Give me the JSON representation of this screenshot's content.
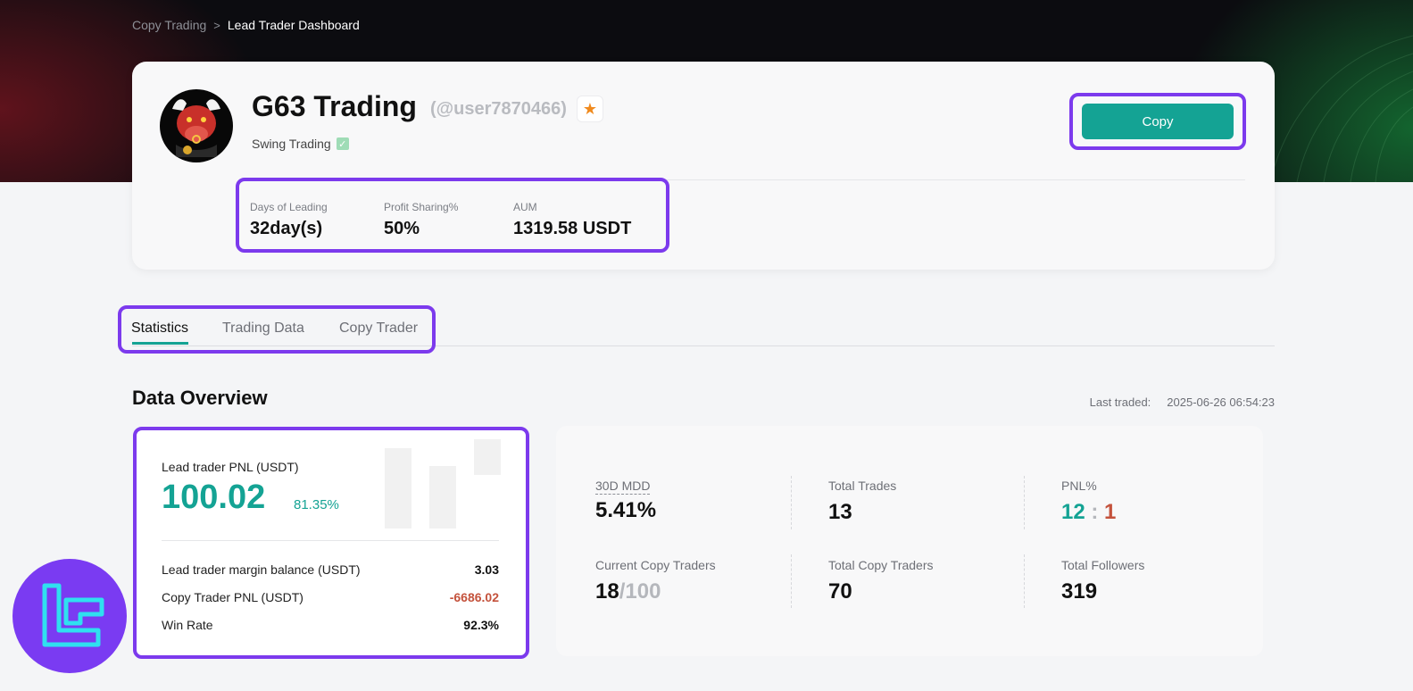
{
  "breadcrumb": {
    "parent": "Copy Trading",
    "separator": ">",
    "current": "Lead Trader Dashboard"
  },
  "profile": {
    "name": "G63 Trading",
    "handle": "(@user7870466)",
    "tag": "Swing Trading",
    "copy_label": "Copy",
    "stats": [
      {
        "label": "Days of Leading",
        "value": "32day(s)"
      },
      {
        "label": "Profit Sharing%",
        "value": "50%"
      },
      {
        "label": "AUM",
        "value": "1319.58 USDT"
      }
    ]
  },
  "tabs": [
    {
      "label": "Statistics",
      "active": true
    },
    {
      "label": "Trading Data",
      "active": false
    },
    {
      "label": "Copy Trader",
      "active": false
    }
  ],
  "overview": {
    "title": "Data Overview",
    "last_traded_label": "Last traded:",
    "last_traded_value": "2025-06-26 06:54:23"
  },
  "pnl_card": {
    "label": "Lead trader PNL (USDT)",
    "value": "100.02",
    "percent": "81.35%",
    "rows": [
      {
        "label": "Lead trader margin balance (USDT)",
        "value": "3.03"
      },
      {
        "label": "Copy Trader PNL (USDT)",
        "value": "-6686.02"
      },
      {
        "label": "Win Rate",
        "value": "92.3%"
      }
    ]
  },
  "metrics": {
    "mdd": {
      "label": "30D MDD",
      "value": "5.41%"
    },
    "total_trades": {
      "label": "Total Trades",
      "value": "13"
    },
    "pnl_ratio": {
      "label": "PNL%",
      "win": "12",
      "sep": ":",
      "loss": "1"
    },
    "current_copy": {
      "label": "Current Copy Traders",
      "current": "18",
      "max": "/100"
    },
    "total_copy": {
      "label": "Total Copy Traders",
      "value": "70"
    },
    "followers": {
      "label": "Total Followers",
      "value": "319"
    }
  },
  "colors": {
    "accent": "#14a394",
    "negative": "#c4523c",
    "highlight_frame": "#7c3aed"
  },
  "icons": [
    "star-icon",
    "verified-check-icon",
    "bull-avatar",
    "brand-logo-icon"
  ]
}
